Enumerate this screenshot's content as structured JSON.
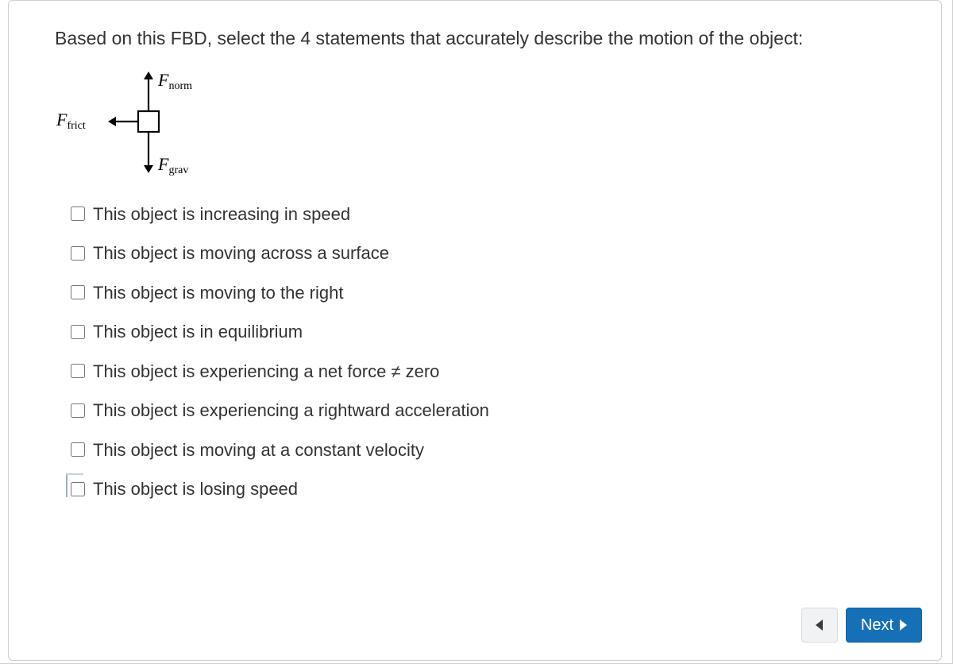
{
  "question": "Based on this FBD, select the 4 statements that accurately describe the motion of the object:",
  "fbd": {
    "forces": {
      "up": {
        "symbol": "F",
        "sub": "norm"
      },
      "left": {
        "symbol": "F",
        "sub": "frict"
      },
      "down": {
        "symbol": "F",
        "sub": "grav"
      }
    }
  },
  "options": [
    {
      "label": "This object is increasing in speed",
      "checked": false
    },
    {
      "label": "This object is moving across a surface",
      "checked": false
    },
    {
      "label": "This object is moving to the right",
      "checked": false
    },
    {
      "label": "This object is in equilibrium",
      "checked": false
    },
    {
      "label": "This object is experiencing a net force ≠ zero",
      "checked": false
    },
    {
      "label": "This object is experiencing a rightward acceleration",
      "checked": false
    },
    {
      "label": "This object is moving at a constant velocity",
      "checked": false
    },
    {
      "label": "This object is losing speed",
      "checked": false
    }
  ],
  "nav": {
    "prev_aria": "Previous",
    "next_label": "Next"
  }
}
